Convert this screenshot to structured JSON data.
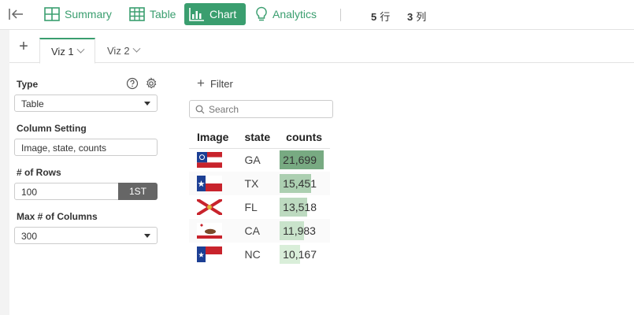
{
  "toolbar": {
    "summary_label": "Summary",
    "table_label": "Table",
    "chart_label": "Chart",
    "analytics_label": "Analytics",
    "rows_count": "5",
    "rows_unit": "行",
    "cols_count": "3",
    "cols_unit": "列",
    "accent_color": "#3a9e6f"
  },
  "tabs": [
    {
      "label": "Viz 1",
      "active": true
    },
    {
      "label": "Viz 2",
      "active": false
    }
  ],
  "config": {
    "type_label": "Type",
    "type_value": "Table",
    "column_setting_label": "Column Setting",
    "column_setting_value": "Image, state, counts",
    "rows_label": "# of Rows",
    "rows_value": "100",
    "rows_button": "1ST",
    "max_columns_label": "Max # of Columns",
    "max_columns_value": "300"
  },
  "filter_label": "Filter",
  "search_placeholder": "Search",
  "table": {
    "headers": [
      "Image",
      "state",
      "counts"
    ],
    "rows": [
      {
        "image": "flag-georgia",
        "state": "GA",
        "counts": "21,699",
        "value": 21699
      },
      {
        "image": "flag-texas",
        "state": "TX",
        "counts": "15,451",
        "value": 15451
      },
      {
        "image": "flag-florida",
        "state": "FL",
        "counts": "13,518",
        "value": 13518
      },
      {
        "image": "flag-california",
        "state": "CA",
        "counts": "11,983",
        "value": 11983
      },
      {
        "image": "flag-north-carolina",
        "state": "NC",
        "counts": "10,167",
        "value": 10167
      }
    ],
    "max_value": 21699
  }
}
